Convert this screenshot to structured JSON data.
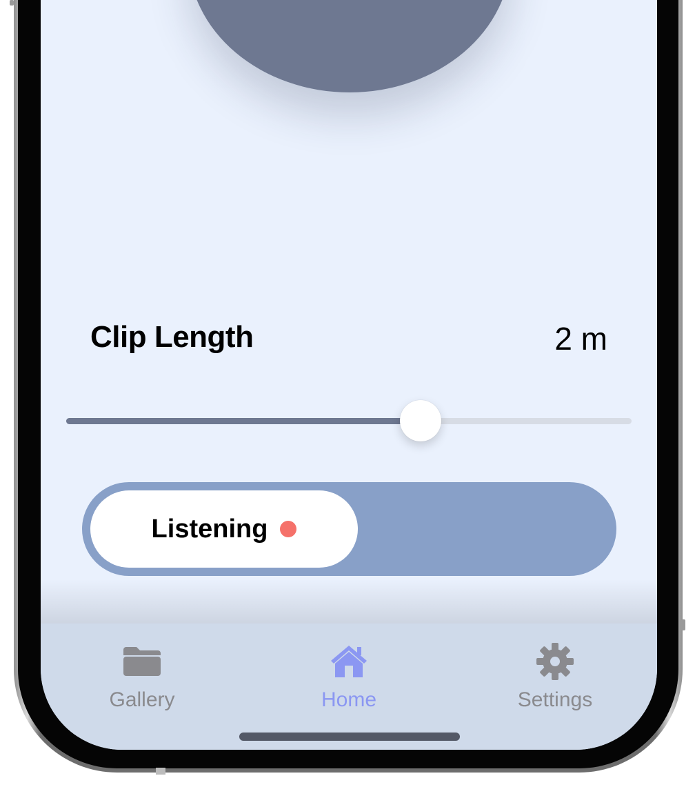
{
  "clip_length": {
    "title": "Clip Length",
    "value": "2 m",
    "slider_fraction": 0.627
  },
  "listening": {
    "label": "Listening",
    "indicator_color": "#f5716a"
  },
  "tab_bar": {
    "active_tab": "Home",
    "tabs": [
      {
        "label": "Gallery",
        "icon": "folder-icon"
      },
      {
        "label": "Home",
        "icon": "house-icon"
      },
      {
        "label": "Settings",
        "icon": "gear-icon"
      }
    ]
  },
  "colors": {
    "background": "#eaf1fd",
    "accent": "#6e7891",
    "toggle_track": "#88a0c8",
    "tab_active": "#8b97f2",
    "tab_inactive": "#8a8a8e",
    "tab_bar": "#cfdaea"
  }
}
